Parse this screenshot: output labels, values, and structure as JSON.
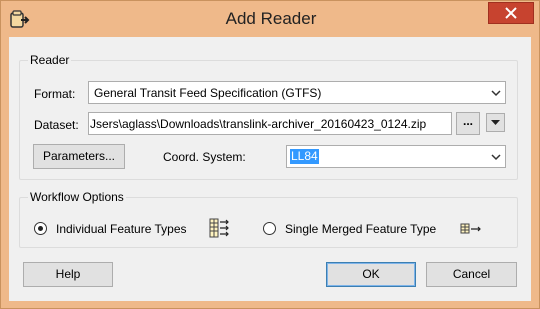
{
  "window": {
    "title": "Add Reader"
  },
  "reader_group": {
    "label": "Reader",
    "format_label": "Format:",
    "format_value": "General Transit Feed Specification (GTFS)",
    "dataset_label": "Dataset:",
    "dataset_value": "Jsers\\aglass\\Downloads\\translink-archiver_20160423_0124.zip",
    "browse_label": "...",
    "parameters_label": "Parameters...",
    "coord_label": "Coord. System:",
    "coord_value": "LL84"
  },
  "workflow_group": {
    "label": "Workflow Options",
    "option1_label": "Individual Feature Types",
    "option1_selected": true,
    "option2_label": "Single Merged Feature Type",
    "option2_selected": false
  },
  "buttons": {
    "help": "Help",
    "ok": "OK",
    "cancel": "Cancel"
  },
  "icons": [
    "reader-icon",
    "close-icon",
    "chevron-down-icon",
    "individual-feature-types-icon",
    "merged-feature-type-icon"
  ]
}
